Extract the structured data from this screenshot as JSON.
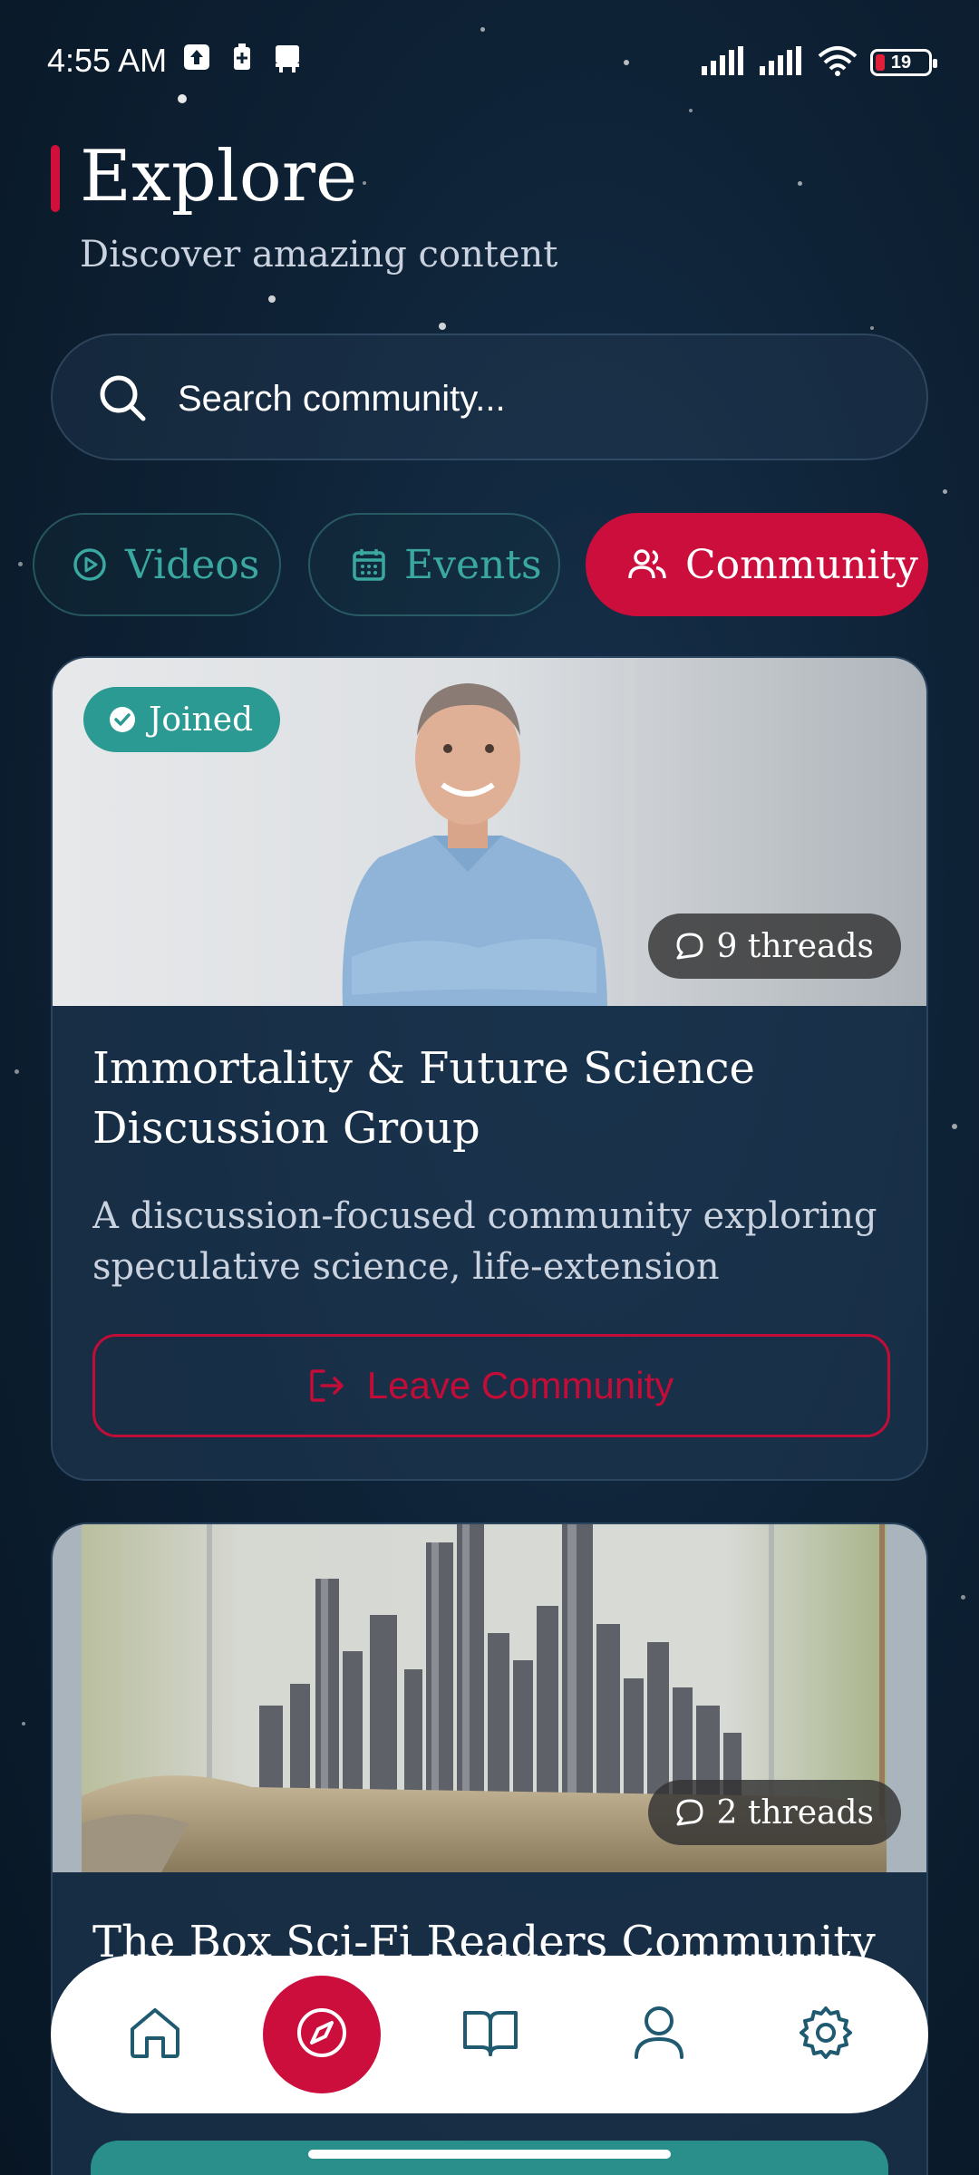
{
  "status_bar": {
    "time": "4:55 AM",
    "battery": "19"
  },
  "header": {
    "title": "Explore",
    "subtitle": "Discover amazing content"
  },
  "search": {
    "placeholder": "Search community..."
  },
  "tabs": [
    {
      "label": "Videos",
      "icon": "play-circle-icon",
      "active": false
    },
    {
      "label": "Events",
      "icon": "calendar-icon",
      "active": false
    },
    {
      "label": "Community",
      "icon": "users-icon",
      "active": true
    }
  ],
  "cards": [
    {
      "badge": "Joined",
      "threads": "9 threads",
      "title": "Immortality & Future Science Discussion Group",
      "description": "A discussion-focused community exploring speculative science, life-extension technology,...",
      "action_label": "Leave Community"
    },
    {
      "threads": "2 threads",
      "title": "The Box Sci-Fi Readers Community"
    }
  ],
  "bottom_nav": [
    "home-icon",
    "compass-icon",
    "book-icon",
    "user-icon",
    "settings-icon"
  ],
  "colors": {
    "accent": "#cc0e3c",
    "teal": "#2a9a92",
    "background": "#0e2236"
  }
}
